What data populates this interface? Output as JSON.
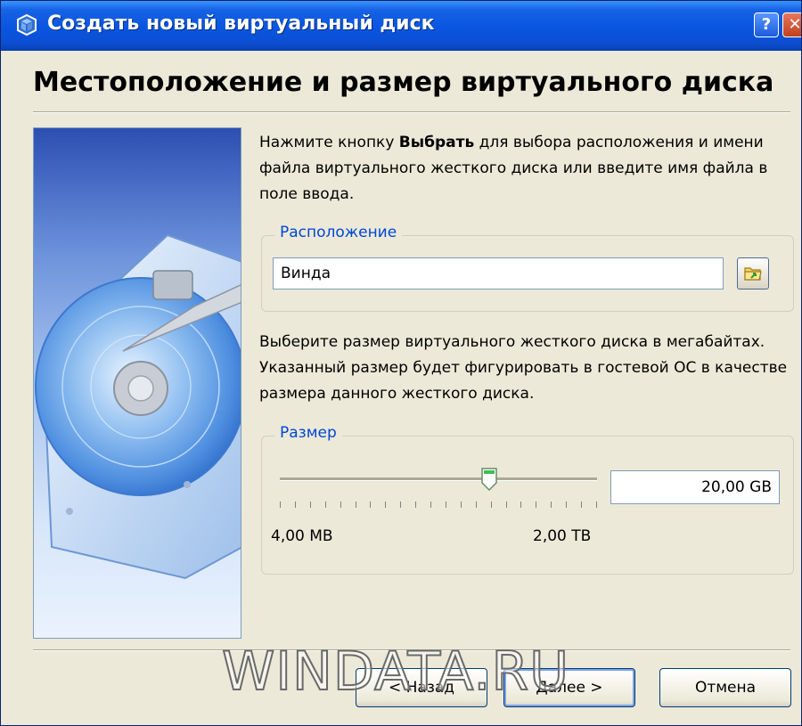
{
  "window": {
    "title": "Создать новый виртуальный диск",
    "help_label": "?",
    "close_label": "✕"
  },
  "page": {
    "heading": "Местоположение и размер виртуального диска",
    "intro_prefix": "Нажмите кнопку ",
    "intro_bold": "Выбрать",
    "intro_suffix": " для выбора расположения и имени файла виртуального жесткого диска или введите имя файла в поле ввода.",
    "size_description": "Выберите размер виртуального жесткого диска в мегабайтах. Указанный размер будет фигурировать в гостевой ОС в качестве размера данного жесткого диска."
  },
  "location": {
    "group_label": "Расположение",
    "value": "Винда",
    "browse_icon": "folder-browse-icon"
  },
  "size": {
    "group_label": "Размер",
    "slider_position": 0.66,
    "min_label": "4,00 MB",
    "max_label": "2,00 TB",
    "value": "20,00 GB"
  },
  "buttons": {
    "back": "< Назад",
    "next": "Далее >",
    "cancel": "Отмена"
  },
  "watermark": "WINDATA.RU",
  "colors": {
    "titlebar": "#0a55e0",
    "dialog_bg": "#ece9d8",
    "group_label": "#0046d5"
  }
}
